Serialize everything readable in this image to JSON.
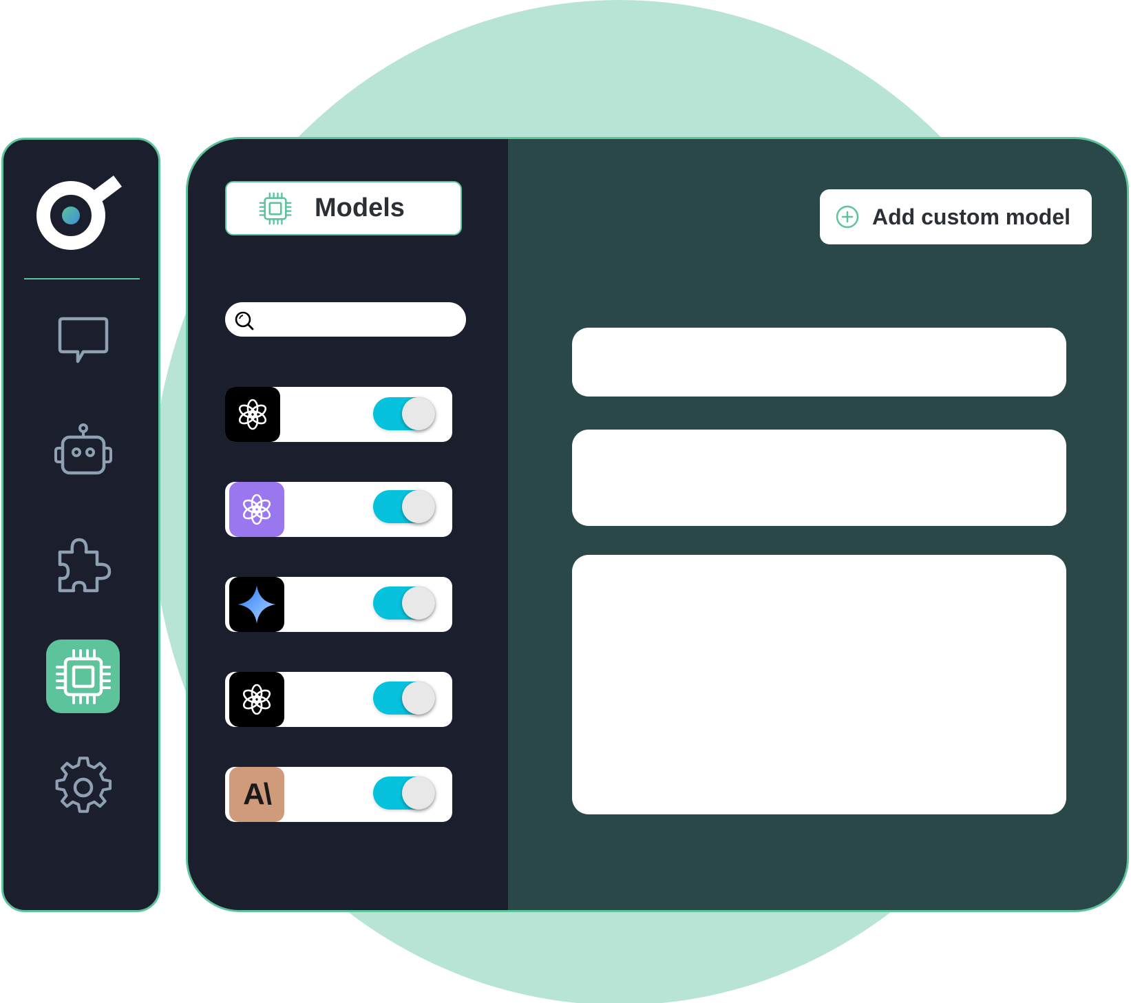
{
  "colors": {
    "mint": "#b7e4d5",
    "navy": "#1b1f2d",
    "teal": "#2b4849",
    "green": "#5cc39a",
    "cyan": "#06c2dd",
    "rail_icon": "#8fa0b3"
  },
  "sidebar": {
    "logo_icon": "app-logo",
    "items": [
      {
        "icon": "chat-bubble-icon",
        "active": false
      },
      {
        "icon": "robot-icon",
        "active": false
      },
      {
        "icon": "puzzle-icon",
        "active": false
      },
      {
        "icon": "chip-icon",
        "active": true
      },
      {
        "icon": "gear-icon",
        "active": false
      }
    ]
  },
  "models_panel": {
    "title": "Models",
    "title_icon": "chip-icon",
    "search": {
      "value": "",
      "placeholder": "",
      "icon": "search-icon"
    },
    "models": [
      {
        "logo": "openai-logo",
        "tile_color": "#000000",
        "enabled": true
      },
      {
        "logo": "openai-logo",
        "tile_color": "#9b77ef",
        "enabled": true
      },
      {
        "logo": "gemini-logo",
        "tile_color": "#000000",
        "enabled": true
      },
      {
        "logo": "openai-logo",
        "tile_color": "#000000",
        "enabled": true
      },
      {
        "logo": "anthropic-logo",
        "tile_color": "#d09b7b",
        "text": "A\\",
        "enabled": true
      }
    ]
  },
  "detail_panel": {
    "add_button_label": "Add custom model",
    "add_button_icon": "plus-circle-icon",
    "fields": [
      "",
      "",
      ""
    ]
  }
}
